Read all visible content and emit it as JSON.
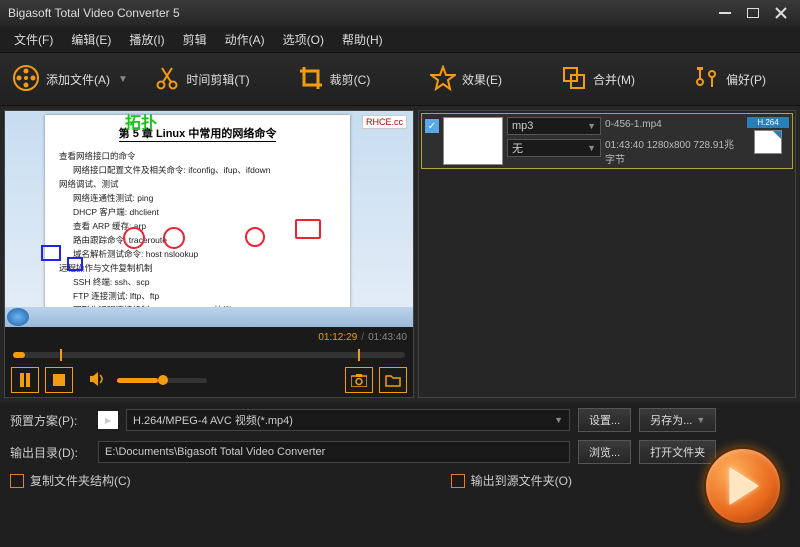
{
  "window": {
    "title": "Bigasoft Total Video Converter 5"
  },
  "menu": {
    "file": "文件(F)",
    "edit": "编辑(E)",
    "play": "播放(I)",
    "trim": "剪辑",
    "action": "动作(A)",
    "option": "选项(O)",
    "help": "帮助(H)"
  },
  "toolbar": {
    "add": "添加文件(A)",
    "timetrim": "时间剪辑(T)",
    "crop": "裁剪(C)",
    "effect": "效果(E)",
    "merge": "合并(M)",
    "pref": "偏好(P)"
  },
  "preview": {
    "doc_title": "第 5 章  Linux 中常用的网络命令",
    "watermark": "RHCE.cc",
    "time_current": "01:12:29",
    "time_total": "01:43:40"
  },
  "list": {
    "item0": {
      "checked": "✓",
      "audio_fmt": "mp3",
      "video_fmt": "无",
      "filename": "0-456-1.mp4",
      "meta": "01:43:40 1280x800 728.91兆字节",
      "badge": "H.264"
    }
  },
  "profile": {
    "label": "预置方案(P):",
    "value": "H.264/MPEG-4 AVC 视频(*.mp4)",
    "settings_btn": "设置...",
    "saveas_btn": "另存为..."
  },
  "output": {
    "label": "输出目录(D):",
    "value": "E:\\Documents\\Bigasoft Total Video Converter",
    "browse_btn": "浏览...",
    "open_btn": "打开文件夹"
  },
  "checks": {
    "keep_structure": "复制文件夹结构(C)",
    "to_source": "输出到源文件夹(O)"
  }
}
